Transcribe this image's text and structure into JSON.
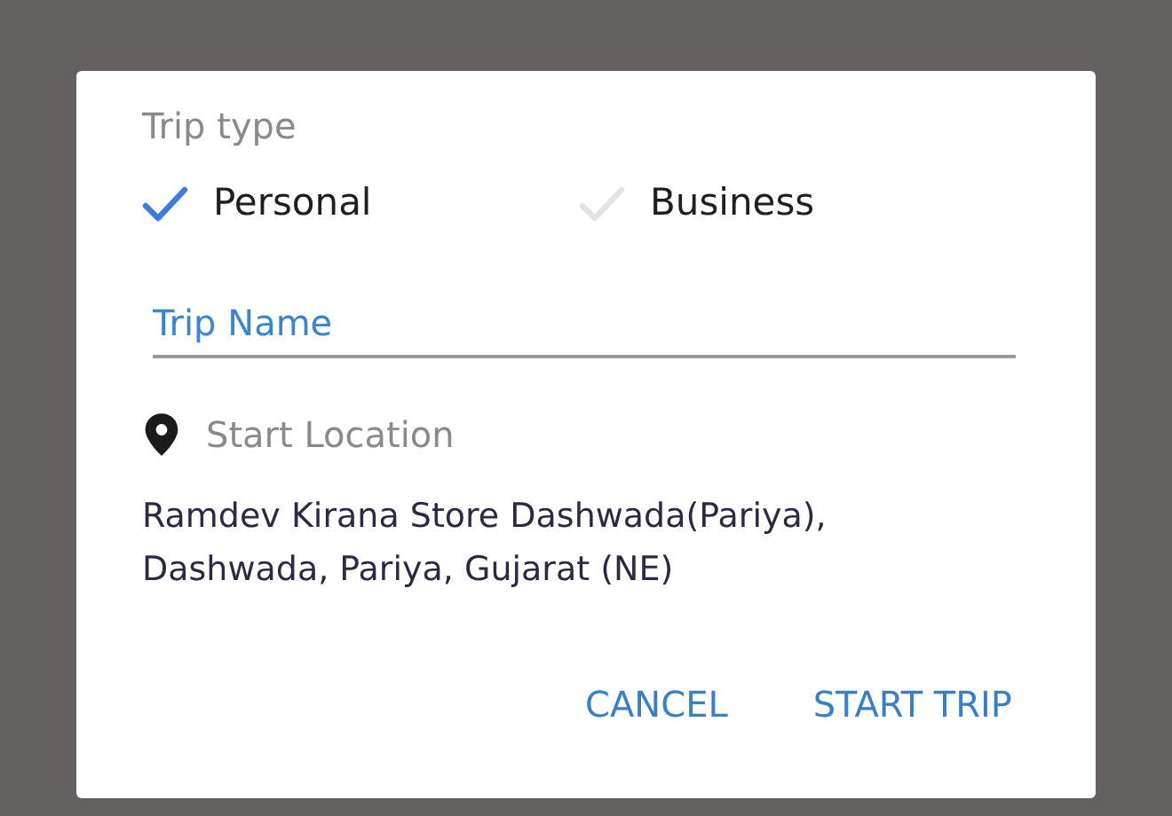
{
  "dialog": {
    "section_label": "Trip type",
    "trip_types": [
      {
        "label": "Personal",
        "selected": true
      },
      {
        "label": "Business",
        "selected": false
      }
    ],
    "trip_name": {
      "placeholder": "Trip Name"
    },
    "start_location": {
      "label": "Start Location",
      "address": "Ramdev Kirana Store Dashwada(Pariya), Dashwada, Pariya, Gujarat (NE)"
    },
    "buttons": [
      "CANCEL",
      "START TRIP"
    ]
  }
}
